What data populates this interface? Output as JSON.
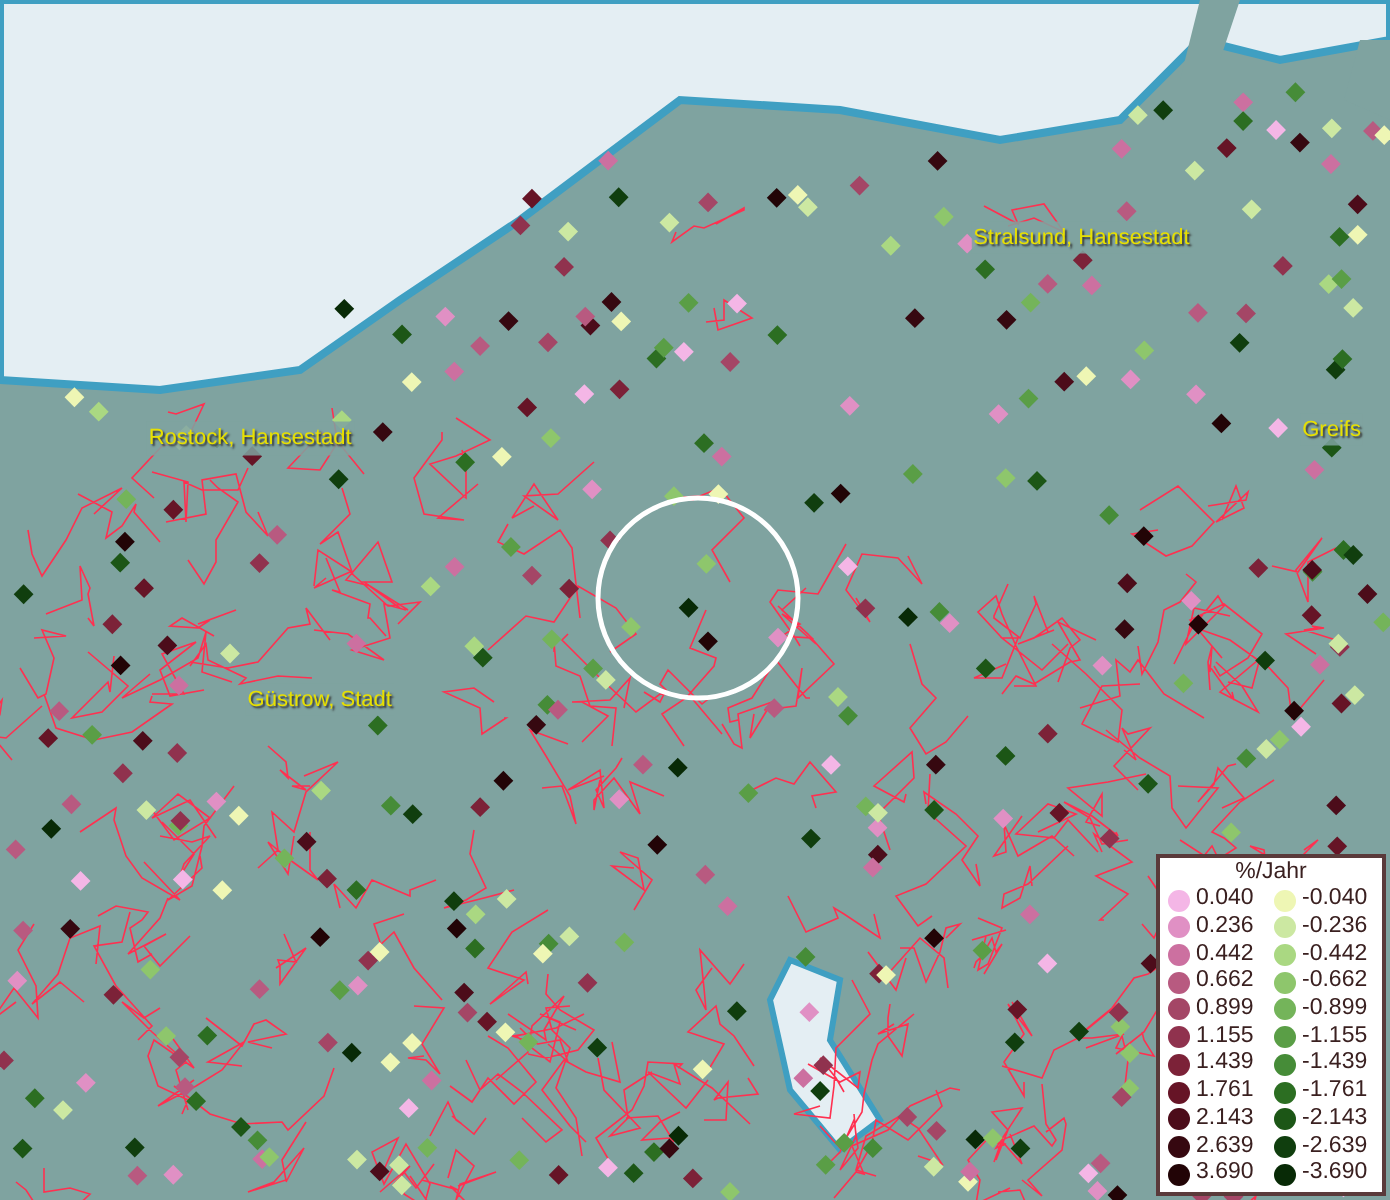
{
  "map": {
    "places": [
      {
        "name": "Rostock, Hansestadt"
      },
      {
        "name": "Stralsund, Hansestadt"
      },
      {
        "name": "Greifs"
      },
      {
        "name": "Güstrow, Stadt"
      }
    ]
  },
  "legend": {
    "title": "%/Jahr",
    "positive": [
      {
        "label": "0.040",
        "color": "#f4b6e6"
      },
      {
        "label": "0.236",
        "color": "#e090c4"
      },
      {
        "label": "0.442",
        "color": "#cc70a0"
      },
      {
        "label": "0.662",
        "color": "#b85a80"
      },
      {
        "label": "0.899",
        "color": "#a44666"
      },
      {
        "label": "1.155",
        "color": "#90324e"
      },
      {
        "label": "1.439",
        "color": "#7c2238"
      },
      {
        "label": "1.761",
        "color": "#661426"
      },
      {
        "label": "2.143",
        "color": "#4c0c1a"
      },
      {
        "label": "2.639",
        "color": "#360810"
      },
      {
        "label": "3.690",
        "color": "#220406"
      }
    ],
    "negative": [
      {
        "label": "-0.040",
        "color": "#eef6b4"
      },
      {
        "label": "-0.236",
        "color": "#cce8a2"
      },
      {
        "label": "-0.442",
        "color": "#aad882"
      },
      {
        "label": "-0.662",
        "color": "#8ec66c"
      },
      {
        "label": "-0.899",
        "color": "#74b45a"
      },
      {
        "label": "-1.155",
        "color": "#5a9e46"
      },
      {
        "label": "-1.439",
        "color": "#468c38"
      },
      {
        "label": "-1.761",
        "color": "#2c6e22"
      },
      {
        "label": "-2.143",
        "color": "#1c5616"
      },
      {
        "label": "-2.639",
        "color": "#103e0e"
      },
      {
        "label": "-3.690",
        "color": "#082a06"
      }
    ]
  }
}
